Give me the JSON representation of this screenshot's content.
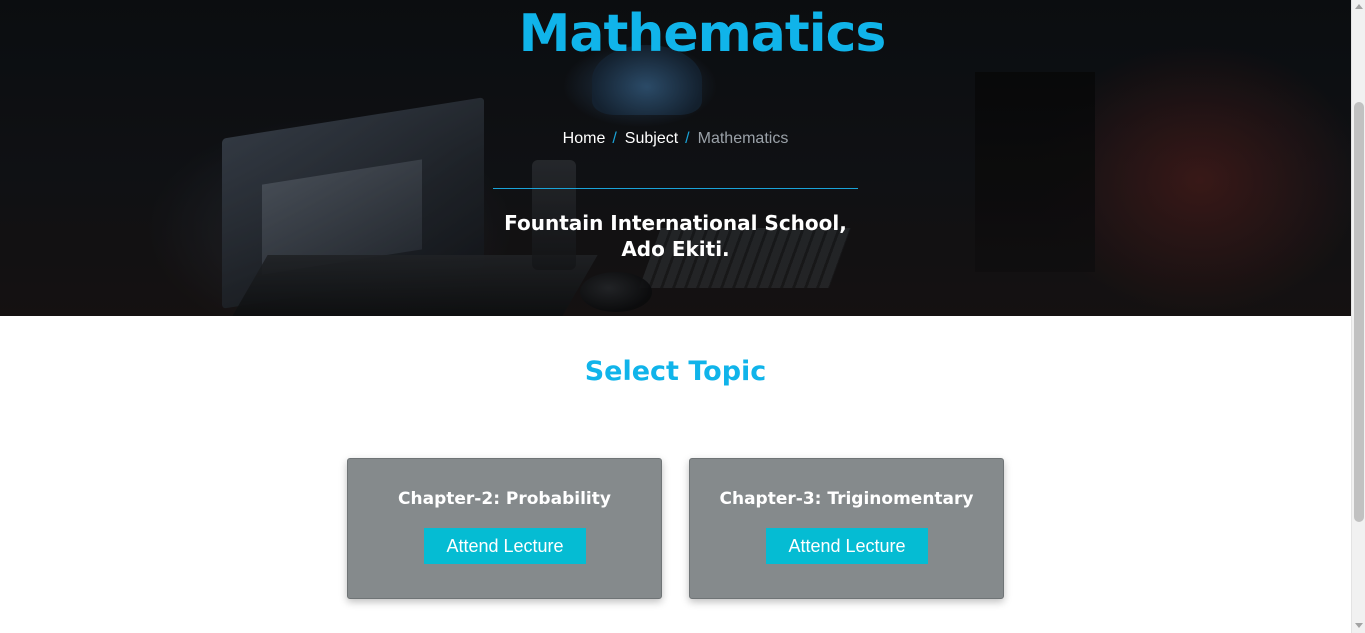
{
  "hero": {
    "title": "Mathematics",
    "breadcrumb": {
      "items": [
        "Home",
        "Subject"
      ],
      "separator": "/",
      "current": "Mathematics"
    },
    "school_line1": "Fountain International School,",
    "school_line2": "Ado Ekiti."
  },
  "topics": {
    "heading": "Select Topic",
    "cards": [
      {
        "title": "Chapter-2: Probability",
        "button_label": "Attend Lecture"
      },
      {
        "title": "Chapter-3: Triginomentary",
        "button_label": "Attend Lecture"
      }
    ]
  },
  "colors": {
    "accent": "#10b4ea",
    "button": "#05bcd3",
    "card_background": "#858a8c"
  }
}
